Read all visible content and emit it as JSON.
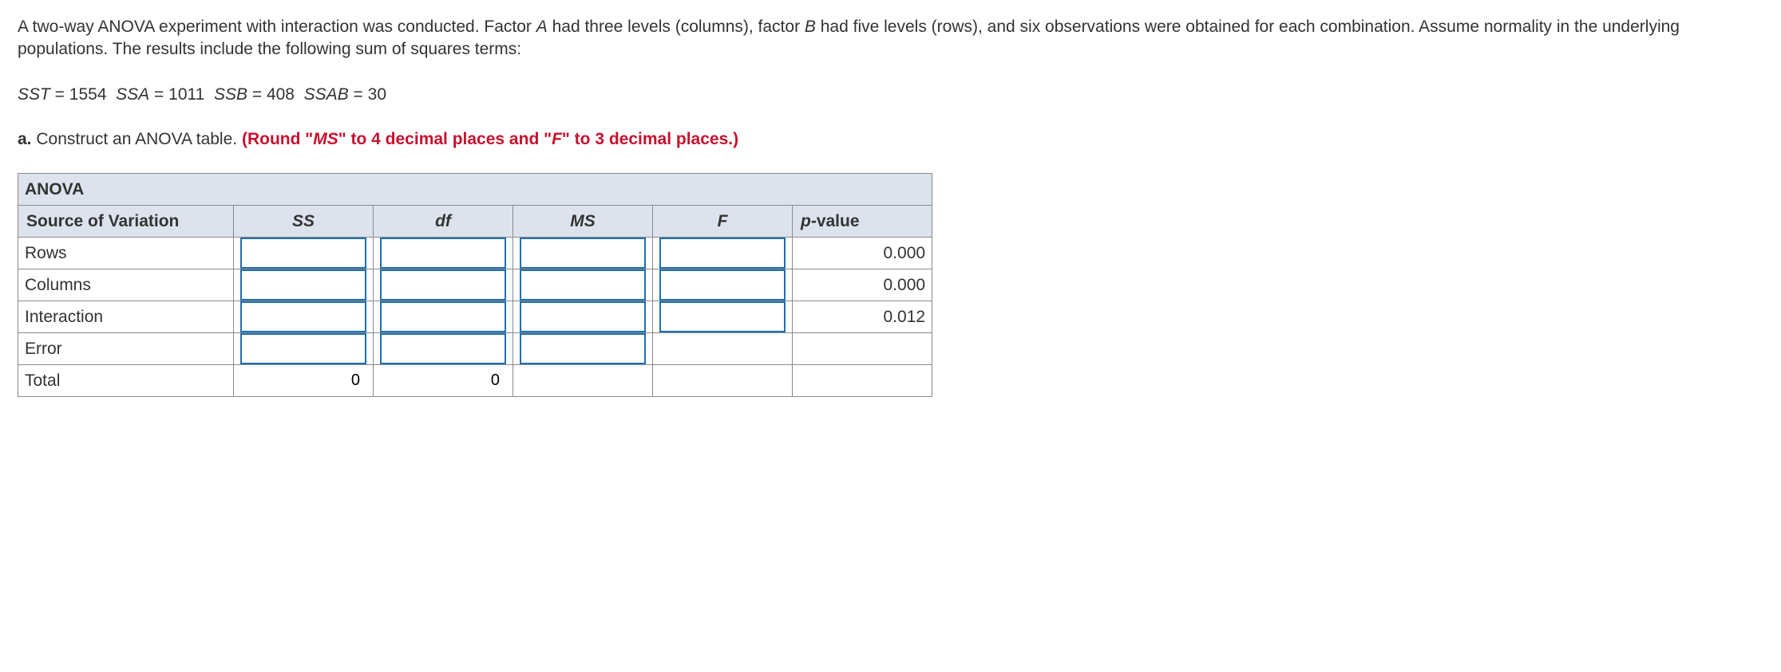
{
  "problem": {
    "paragraph": "A two-way ANOVA experiment with interaction was conducted. Factor A had three levels (columns), factor B had five levels (rows), and six observations were obtained for each combination. Assume normality in the underlying populations. The results include the following sum of squares terms:",
    "factor_a": "A",
    "factor_b": "B"
  },
  "sums": {
    "sst_label": "SST",
    "sst_val": "1554",
    "ssa_label": "SSA",
    "ssa_val": "1011",
    "ssb_label": "SSB",
    "ssb_val": "408",
    "ssab_label": "SSAB",
    "ssab_val": "30"
  },
  "part_a": {
    "prefix": "a.",
    "text": "Construct an ANOVA table.",
    "instruction": "(Round \"MS\" to 4 decimal places and \"F\" to 3 decimal places.)",
    "ms_label": "MS",
    "f_label": "F"
  },
  "table": {
    "title": "ANOVA",
    "headers": {
      "source": "Source of Variation",
      "ss": "SS",
      "df": "df",
      "ms": "MS",
      "f": "F",
      "pvalue": "p-value"
    },
    "rows": [
      {
        "label": "Rows",
        "ss": "",
        "df": "",
        "ms": "",
        "f": "",
        "pvalue": "0.000"
      },
      {
        "label": "Columns",
        "ss": "",
        "df": "",
        "ms": "",
        "f": "",
        "pvalue": "0.000"
      },
      {
        "label": "Interaction",
        "ss": "",
        "df": "",
        "ms": "",
        "f": "",
        "pvalue": "0.012"
      },
      {
        "label": "Error",
        "ss": "",
        "df": "",
        "ms": "",
        "f": null,
        "pvalue": ""
      },
      {
        "label": "Total",
        "ss": "0",
        "df": "0",
        "ms": null,
        "f": null,
        "pvalue": ""
      }
    ]
  }
}
